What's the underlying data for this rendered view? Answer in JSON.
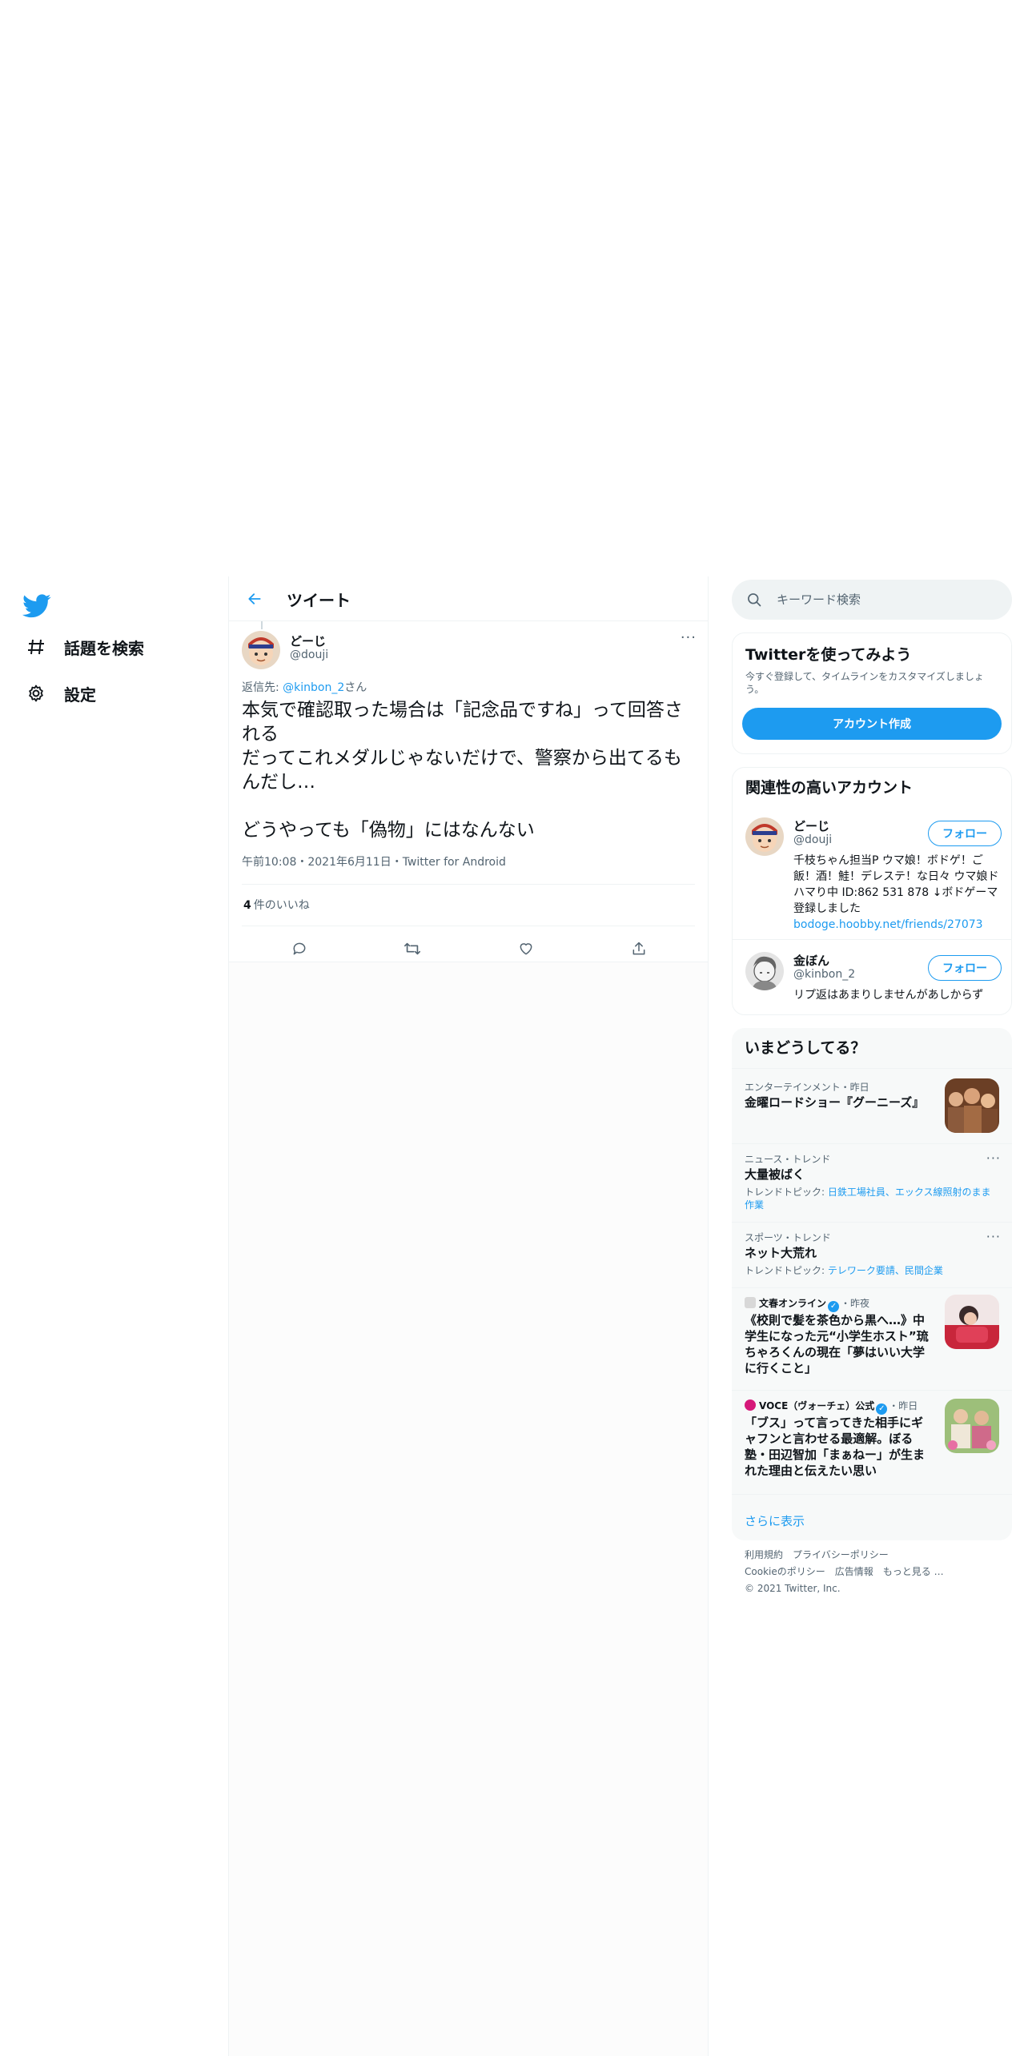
{
  "nav": {
    "logo": "twitter-bird-icon",
    "explore_label": "話題を検索",
    "settings_label": "設定"
  },
  "header": {
    "title": "ツイート"
  },
  "tweet": {
    "author_name": "どーじ",
    "author_handle": "@douji",
    "reply_prefix": "返信先: ",
    "reply_to": "@kinbon_2",
    "reply_suffix": "さん",
    "text": "本気で確認取った場合は「記念品ですね」って回答される\nだってこれメダルじゃないだけで、警察から出てるもんだし…\n\nどうやっても「偽物」にはなんない",
    "meta": "午前10:08・2021年6月11日・Twitter for Android",
    "likes_count": "4",
    "likes_label": "件のいいね"
  },
  "search": {
    "placeholder": "キーワード検索"
  },
  "signup": {
    "title": "Twitterを使ってみよう",
    "description": "今すぐ登録して、タイムラインをカスタマイズしましょう。",
    "button": "アカウント作成"
  },
  "related": {
    "title": "関連性の高いアカウント",
    "users": [
      {
        "name": "どーじ",
        "handle": "@douji",
        "follow": "フォロー",
        "bio": "千枝ちゃん担当P ウマ娘！ボドゲ！ご飯！酒！鮭！デレステ！な日々 ウマ娘ドハマり中 ID:862 531 878 ↓ボドゲーマ登録しました",
        "link": "bodoge.hoobby.net/friends/27073"
      },
      {
        "name": "金ぼん",
        "handle": "@kinbon_2",
        "follow": "フォロー",
        "bio": "リプ返はあまりしませんがあしからず"
      }
    ]
  },
  "trends": {
    "title": "いまどうしてる？",
    "items": [
      {
        "meta": "エンターテインメント・昨日",
        "title": "金曜ロードショー『グーニーズ』"
      },
      {
        "meta": "ニュース・トレンド",
        "title": "大量被ばく",
        "topics_prefix": "トレンドトピック: ",
        "topics": "日鉄工場社員、エックス線照射のまま作業"
      },
      {
        "meta": "スポーツ・トレンド",
        "title": "ネット大荒れ",
        "topics_prefix": "トレンドトピック: ",
        "topics": "テレワーク要請、民間企業"
      },
      {
        "source": "文春オンライン",
        "time": "・昨夜",
        "title": "《校則で髪を茶色から黒へ…》中学生になった元“小学生ホスト”琉ちゃろくんの現在「夢はいい大学に行くこと」"
      },
      {
        "source": "VOCE（ヴォーチェ）公式",
        "time": "・昨日",
        "title": "「ブス」って言ってきた相手にギャフンと言わせる最適解。ぼる塾・田辺智加「まぁねー」が生まれた理由と伝えたい思い"
      }
    ],
    "show_more": "さらに表示"
  },
  "footer": {
    "terms": "利用規約",
    "privacy": "プライバシーポリシー",
    "cookie": "Cookieのポリシー",
    "ads": "広告情報",
    "more": "もっと見る …",
    "copyright": "© 2021 Twitter, Inc."
  },
  "colors": {
    "accent": "#1d9bf0",
    "text": "#0f1419",
    "secondary": "#536471"
  }
}
